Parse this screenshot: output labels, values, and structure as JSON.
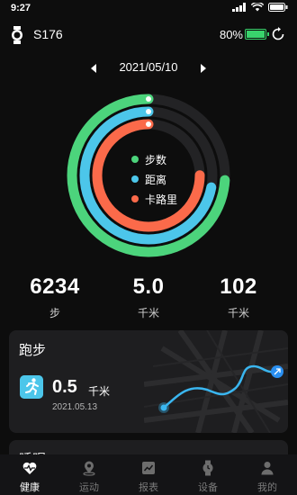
{
  "status_bar": {
    "time": "9:27"
  },
  "device": {
    "name": "S176",
    "battery": "80%"
  },
  "date_selector": {
    "date": "2021/05/10"
  },
  "ring": {
    "legend": [
      {
        "label": "步数",
        "color": "#4cd47c"
      },
      {
        "label": "距离",
        "color": "#4cc6ea"
      },
      {
        "label": "卡路里",
        "color": "#fb6a4a"
      }
    ],
    "progress": [
      0.74,
      0.72,
      0.75
    ]
  },
  "stats": [
    {
      "value": "6234",
      "unit": "步"
    },
    {
      "value": "5.0",
      "unit": "千米"
    },
    {
      "value": "102",
      "unit": "千米"
    }
  ],
  "run_card": {
    "title": "跑步",
    "value": "0.5",
    "unit": "千米",
    "date": "2021.05.13"
  },
  "next_card": {
    "title": "睡眠"
  },
  "tabs": [
    {
      "label": "健康",
      "icon": "heart-pulse-icon",
      "active": true
    },
    {
      "label": "运动",
      "icon": "location-pin-icon",
      "active": false
    },
    {
      "label": "报表",
      "icon": "chart-icon",
      "active": false
    },
    {
      "label": "设备",
      "icon": "watch-icon",
      "active": false
    },
    {
      "label": "我的",
      "icon": "person-icon",
      "active": false
    }
  ],
  "colors": {
    "accent_green": "#39d36c",
    "steps": "#4cd47c",
    "distance": "#4cc6ea",
    "calories": "#fb6a4a"
  }
}
